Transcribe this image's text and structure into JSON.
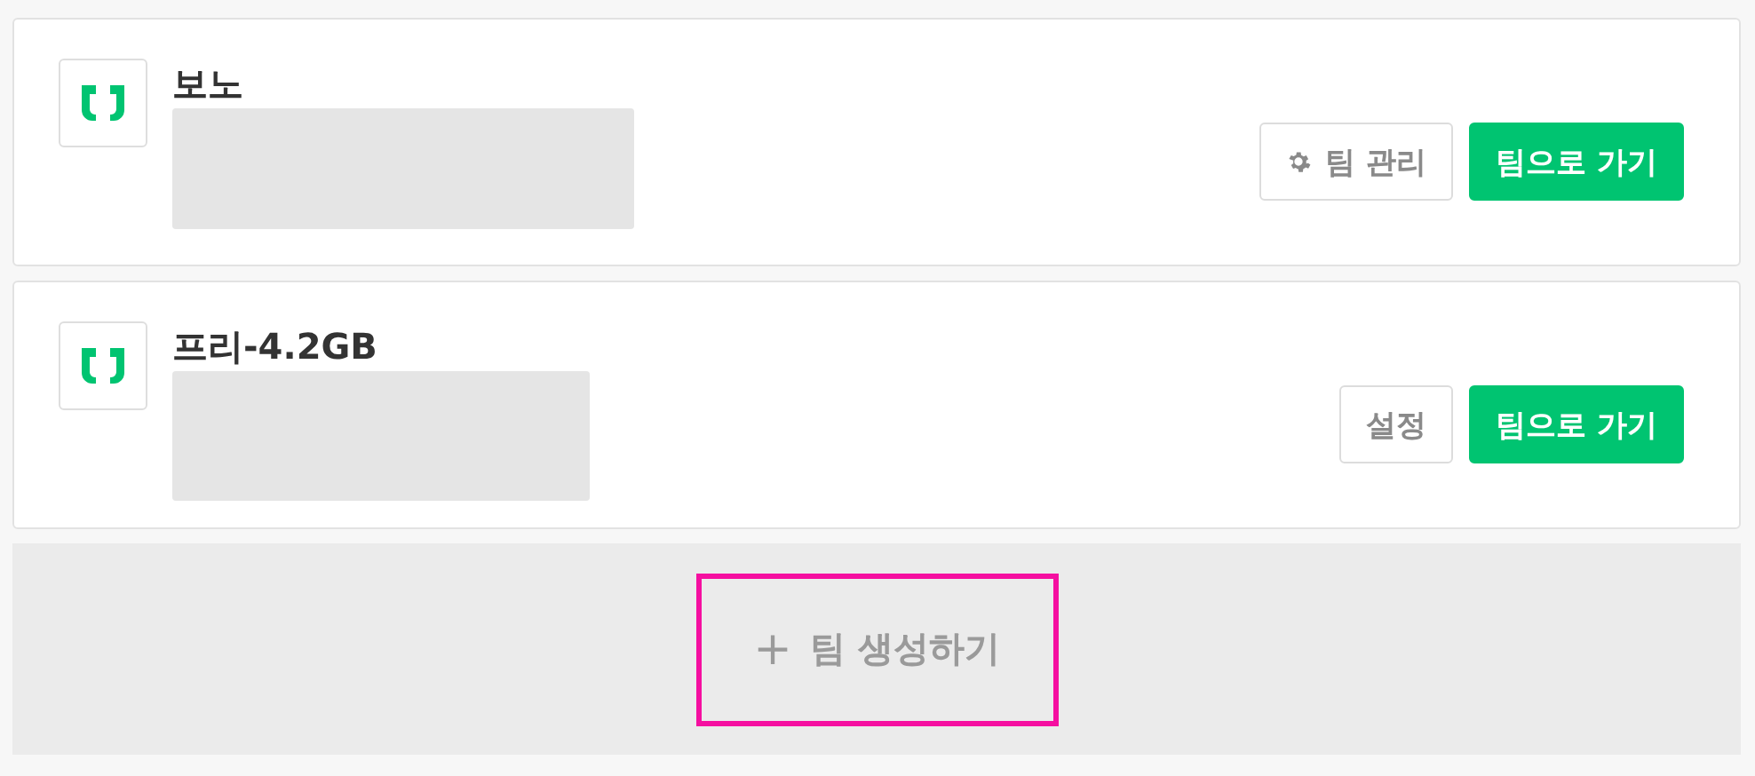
{
  "teams": [
    {
      "name": "보노",
      "buttons": [
        {
          "kind": "manage",
          "label": "팀 관리"
        },
        {
          "kind": "primary",
          "label": "팀으로 가기"
        }
      ]
    },
    {
      "name": "프리-4.2GB",
      "buttons": [
        {
          "kind": "settings",
          "label": "설정"
        },
        {
          "kind": "primary",
          "label": "팀으로 가기"
        }
      ]
    }
  ],
  "create": {
    "icon": "+",
    "label": "팀 생성하기",
    "highlighted": true
  }
}
